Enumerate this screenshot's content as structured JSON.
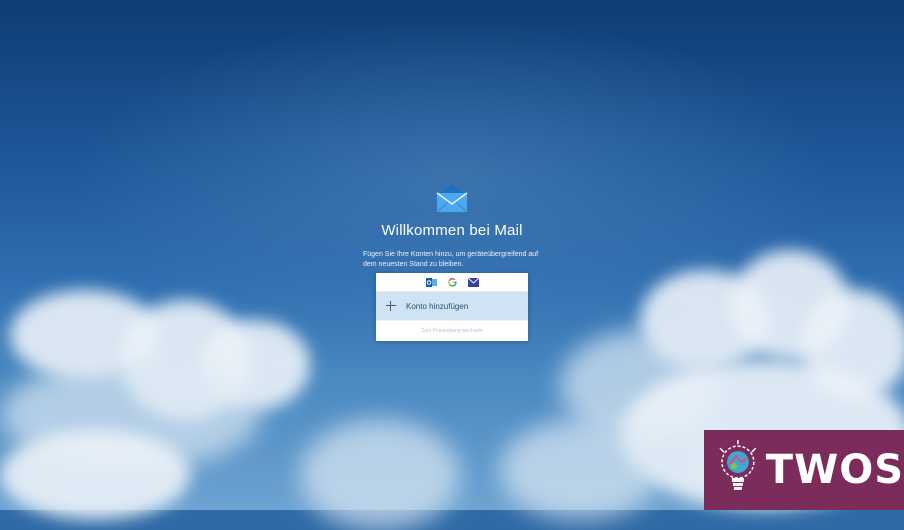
{
  "welcome": {
    "title": "Willkommen bei Mail",
    "subtitle": "Fügen Sie Ihre Konten hinzu, um geräteübergreifend auf dem neuesten Stand zu bleiben."
  },
  "providers": [
    {
      "icon": "outlook-icon"
    },
    {
      "icon": "google-icon"
    },
    {
      "icon": "mail-envelope-icon"
    }
  ],
  "actions": {
    "add_account": "Konto hinzufügen",
    "go_to_inbox": "Zum Posteingang wechseln"
  },
  "watermark": {
    "text": "TWOS",
    "background": "#7b2c5b"
  },
  "colors": {
    "accent": "#2a7fd4",
    "add_row_bg": "#cfe3f4"
  }
}
